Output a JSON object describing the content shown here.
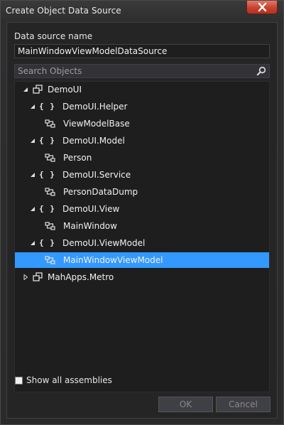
{
  "window": {
    "title": "Create Object Data Source"
  },
  "data_source": {
    "label": "Data source name",
    "value": "MainWindowViewModelDataSource"
  },
  "search": {
    "placeholder": "Search Objects",
    "icon": "search-icon"
  },
  "tree": {
    "items": [
      {
        "label": "DemoUI",
        "kind": "assembly",
        "expanded": true,
        "level": 0
      },
      {
        "label": "DemoUI.Helper",
        "kind": "namespace",
        "expanded": true,
        "level": 1
      },
      {
        "label": "ViewModelBase",
        "kind": "class",
        "level": 2
      },
      {
        "label": "DemoUI.Model",
        "kind": "namespace",
        "expanded": true,
        "level": 1
      },
      {
        "label": "Person",
        "kind": "class",
        "level": 2
      },
      {
        "label": "DemoUI.Service",
        "kind": "namespace",
        "expanded": true,
        "level": 1
      },
      {
        "label": "PersonDataDump",
        "kind": "class",
        "level": 2
      },
      {
        "label": "DemoUI.View",
        "kind": "namespace",
        "expanded": true,
        "level": 1
      },
      {
        "label": "MainWindow",
        "kind": "class",
        "level": 2
      },
      {
        "label": "DemoUI.ViewModel",
        "kind": "namespace",
        "expanded": true,
        "level": 1
      },
      {
        "label": "MainWindowViewModel",
        "kind": "class",
        "level": 2,
        "selected": true
      },
      {
        "label": "MahApps.Metro",
        "kind": "assembly",
        "expanded": false,
        "level": 0
      }
    ],
    "namespace_glyph": "{ }"
  },
  "options": {
    "show_all_assemblies_label": "Show all assemblies",
    "show_all_assemblies_checked": false
  },
  "buttons": {
    "ok": "OK",
    "cancel": "Cancel"
  },
  "colors": {
    "selection": "#3399ff",
    "close_button": "#c7432f",
    "background": "#1e1e1e"
  }
}
